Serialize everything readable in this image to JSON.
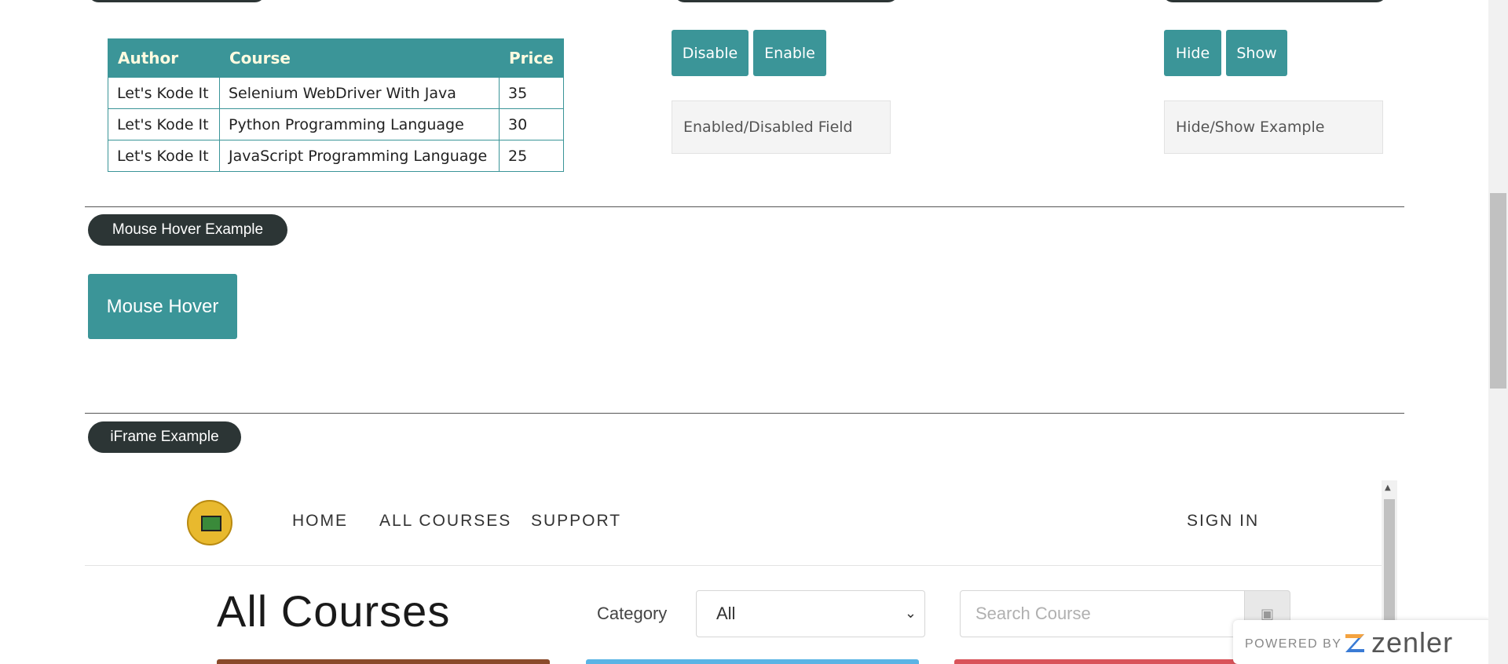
{
  "table": {
    "headers": [
      "Author",
      "Course",
      "Price"
    ],
    "rows": [
      [
        "Let's Kode It",
        "Selenium WebDriver With Java",
        "35"
      ],
      [
        "Let's Kode It",
        "Python Programming Language",
        "30"
      ],
      [
        "Let's Kode It",
        "JavaScript Programming Language",
        "25"
      ]
    ]
  },
  "enable_disable": {
    "disable_label": "Disable",
    "enable_label": "Enable",
    "field_placeholder": "Enabled/Disabled Field"
  },
  "hide_show": {
    "hide_label": "Hide",
    "show_label": "Show",
    "field_placeholder": "Hide/Show Example"
  },
  "mouse_hover": {
    "section_title": "Mouse Hover Example",
    "button_label": "Mouse Hover"
  },
  "iframe_section": {
    "section_title": "iFrame Example",
    "nav": {
      "home": "HOME",
      "all_courses": "ALL COURSES",
      "support": "SUPPORT",
      "sign_in": "SIGN IN"
    },
    "page_title": "All Courses",
    "category_label": "Category",
    "category_value": "All",
    "search_placeholder": "Search Course",
    "card_colors": [
      "#8a4a2a",
      "#5ab4e5",
      "#d9535a"
    ]
  },
  "powered_by": {
    "text": "POWERED BY",
    "brand": "zenler"
  },
  "colors": {
    "accent_teal": "#3b9598",
    "pill_dark": "#2c3535"
  }
}
